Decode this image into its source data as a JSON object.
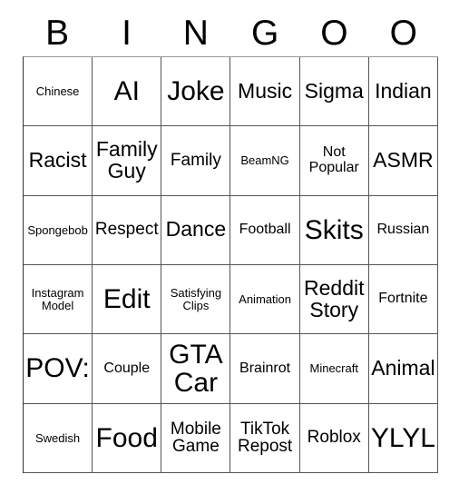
{
  "card": {
    "title": "BINGOO",
    "header_letters": [
      "B",
      "I",
      "N",
      "G",
      "O",
      "O"
    ],
    "columns": 6,
    "rows": 6,
    "colors": {
      "background": "#ffffff",
      "text": "#000000",
      "grid_line": "#555555",
      "grid_line_top": "#999999"
    },
    "cells": [
      {
        "text": "Chinese",
        "size": "s-xs"
      },
      {
        "text": "AI",
        "size": "s-xxl"
      },
      {
        "text": "Joke",
        "size": "s-xxl"
      },
      {
        "text": "Music",
        "size": "s-lg"
      },
      {
        "text": "Sigma",
        "size": "s-lg"
      },
      {
        "text": "Indian",
        "size": "s-lg"
      },
      {
        "text": "Racist",
        "size": "s-lg"
      },
      {
        "text": "Family\nGuy",
        "size": "s-lg"
      },
      {
        "text": "Family",
        "size": "s-md"
      },
      {
        "text": "BeamNG",
        "size": "s-xs"
      },
      {
        "text": "Not\nPopular",
        "size": "s-sm"
      },
      {
        "text": "ASMR",
        "size": "s-lg"
      },
      {
        "text": "Spongebob",
        "size": "s-xs"
      },
      {
        "text": "Respect",
        "size": "s-md"
      },
      {
        "text": "Dance",
        "size": "s-lg"
      },
      {
        "text": "Football",
        "size": "s-sm"
      },
      {
        "text": "Skits",
        "size": "s-xxl"
      },
      {
        "text": "Russian",
        "size": "s-sm"
      },
      {
        "text": "Instagram\nModel",
        "size": "s-xs"
      },
      {
        "text": "Edit",
        "size": "s-xxl"
      },
      {
        "text": "Satisfying\nClips",
        "size": "s-xs"
      },
      {
        "text": "Animation",
        "size": "s-xs"
      },
      {
        "text": "Reddit\nStory",
        "size": "s-lg"
      },
      {
        "text": "Fortnite",
        "size": "s-sm"
      },
      {
        "text": "POV:",
        "size": "s-xxl"
      },
      {
        "text": "Couple",
        "size": "s-sm"
      },
      {
        "text": "GTA\nCar",
        "size": "s-xxl"
      },
      {
        "text": "Brainrot",
        "size": "s-sm"
      },
      {
        "text": "Minecraft",
        "size": "s-xs"
      },
      {
        "text": "Animal",
        "size": "s-lg"
      },
      {
        "text": "Swedish",
        "size": "s-xs"
      },
      {
        "text": "Food",
        "size": "s-xxl"
      },
      {
        "text": "Mobile\nGame",
        "size": "s-md"
      },
      {
        "text": "TikTok\nRepost",
        "size": "s-md"
      },
      {
        "text": "Roblox",
        "size": "s-md"
      },
      {
        "text": "YLYL",
        "size": "s-xxl"
      }
    ]
  }
}
